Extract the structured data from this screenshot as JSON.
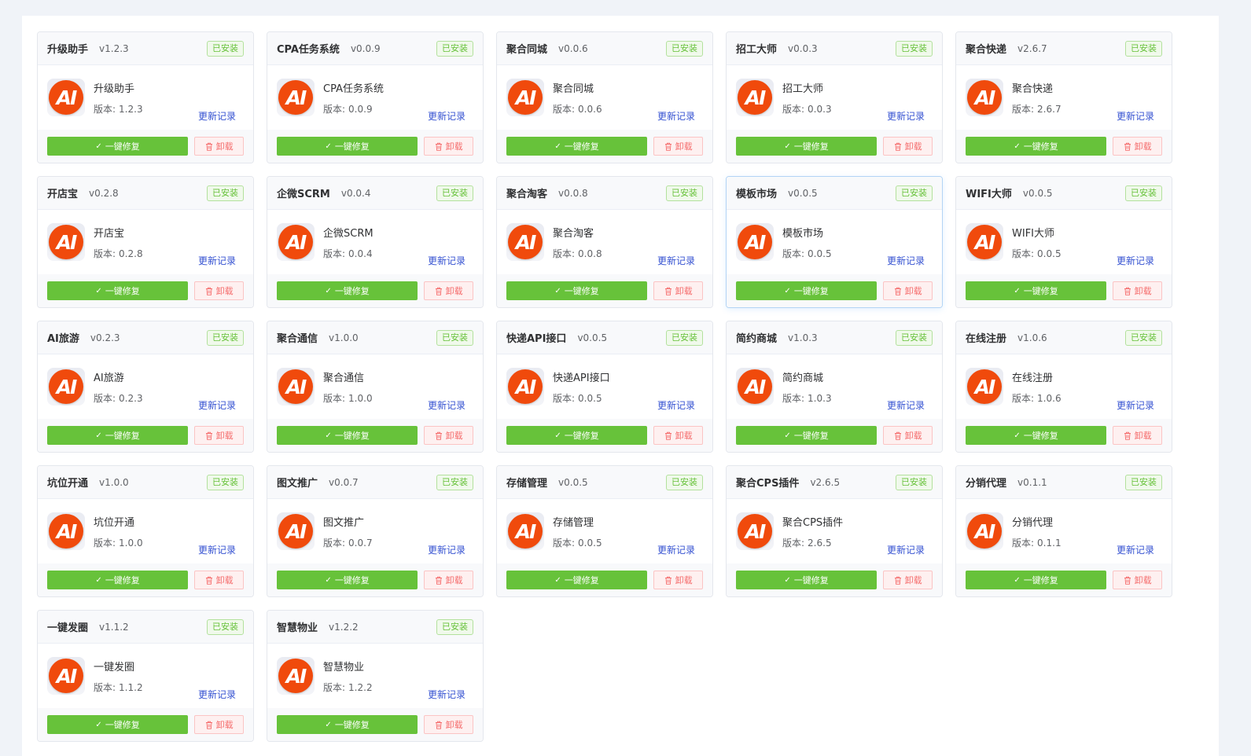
{
  "labels": {
    "installed": "已安装",
    "version_prefix": "版本:",
    "changelog": "更新记录",
    "repair": "一键修复",
    "uninstall": "卸载",
    "logo_text": "AI"
  },
  "colors": {
    "repair_green": "#67c23a",
    "installed_green": "#67c23a",
    "uninstall_red": "#f56c6c",
    "changelog_blue": "#3451d1",
    "logo_orange": "#f04a0c"
  },
  "plugins": [
    {
      "name": "升级助手",
      "version": "1.2.3"
    },
    {
      "name": "CPA任务系统",
      "version": "0.0.9"
    },
    {
      "name": "聚合同城",
      "version": "0.0.6"
    },
    {
      "name": "招工大师",
      "version": "0.0.3"
    },
    {
      "name": "聚合快递",
      "version": "2.6.7"
    },
    {
      "name": "开店宝",
      "version": "0.2.8"
    },
    {
      "name": "企微SCRM",
      "version": "0.0.4"
    },
    {
      "name": "聚合淘客",
      "version": "0.0.8"
    },
    {
      "name": "模板市场",
      "version": "0.0.5",
      "hover": true
    },
    {
      "name": "WIFI大师",
      "version": "0.0.5"
    },
    {
      "name": "AI旅游",
      "version": "0.2.3"
    },
    {
      "name": "聚合通信",
      "version": "1.0.0"
    },
    {
      "name": "快递API接口",
      "version": "0.0.5"
    },
    {
      "name": "简约商城",
      "version": "1.0.3"
    },
    {
      "name": "在线注册",
      "version": "1.0.6"
    },
    {
      "name": "坑位开通",
      "version": "1.0.0"
    },
    {
      "name": "图文推广",
      "version": "0.0.7"
    },
    {
      "name": "存储管理",
      "version": "0.0.5"
    },
    {
      "name": "聚合CPS插件",
      "version": "2.6.5"
    },
    {
      "name": "分销代理",
      "version": "0.1.1"
    },
    {
      "name": "一键发圈",
      "version": "1.1.2"
    },
    {
      "name": "智慧物业",
      "version": "1.2.2"
    }
  ]
}
